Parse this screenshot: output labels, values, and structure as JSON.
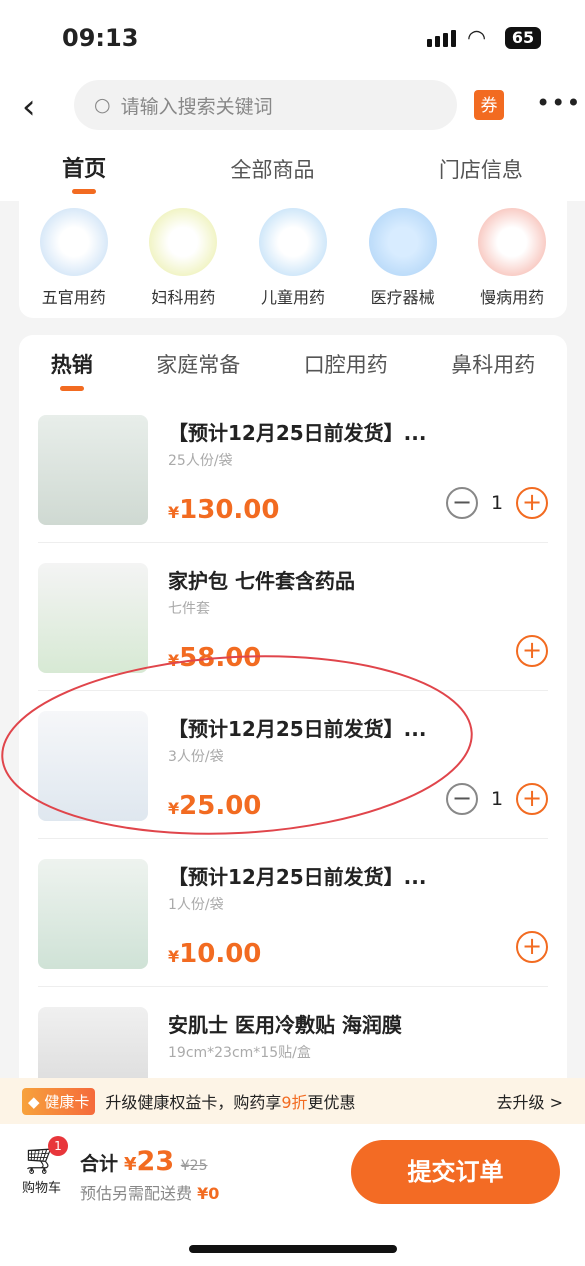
{
  "status": {
    "time": "09:13",
    "battery": "65"
  },
  "header": {
    "search_placeholder": "请输入搜索关键词",
    "coupon": "券",
    "more": "•••"
  },
  "tabs": [
    "首页",
    "全部商品",
    "门店信息"
  ],
  "categories": [
    "五官用药",
    "妇科用药",
    "儿童用药",
    "医疗器械",
    "慢病用药"
  ],
  "product_tabs": [
    "热销",
    "家庭常备",
    "口腔用药",
    "鼻科用药"
  ],
  "products": [
    {
      "name": "【预计12月25日前发货】...",
      "spec": "25人份/袋",
      "price": "130.00",
      "qty": "1"
    },
    {
      "name": "家护包 七件套含药品",
      "spec": "七件套",
      "price": "58.00"
    },
    {
      "name": "【预计12月25日前发货】...",
      "spec": "3人份/袋",
      "price": "25.00",
      "qty": "1"
    },
    {
      "name": "【预计12月25日前发货】...",
      "spec": "1人份/袋",
      "price": "10.00"
    },
    {
      "name": "安肌士 医用冷敷贴 海润膜",
      "spec": "19cm*23cm*15贴/盒"
    }
  ],
  "banner": {
    "badge": "健康卡",
    "text_pre": "升级健康权益卡，购药享",
    "discount": "9折",
    "text_post": "更优惠",
    "action": "去升级 >"
  },
  "bottom": {
    "cart_label": "购物车",
    "cart_count": "1",
    "total_label": "合计",
    "currency": "¥",
    "total": "23",
    "original": "¥25",
    "fee_label": "预估另需配送费",
    "fee": "¥0",
    "submit": "提交订单"
  },
  "colors": {
    "accent": "#f26b21",
    "annotation": "#e0454b"
  }
}
